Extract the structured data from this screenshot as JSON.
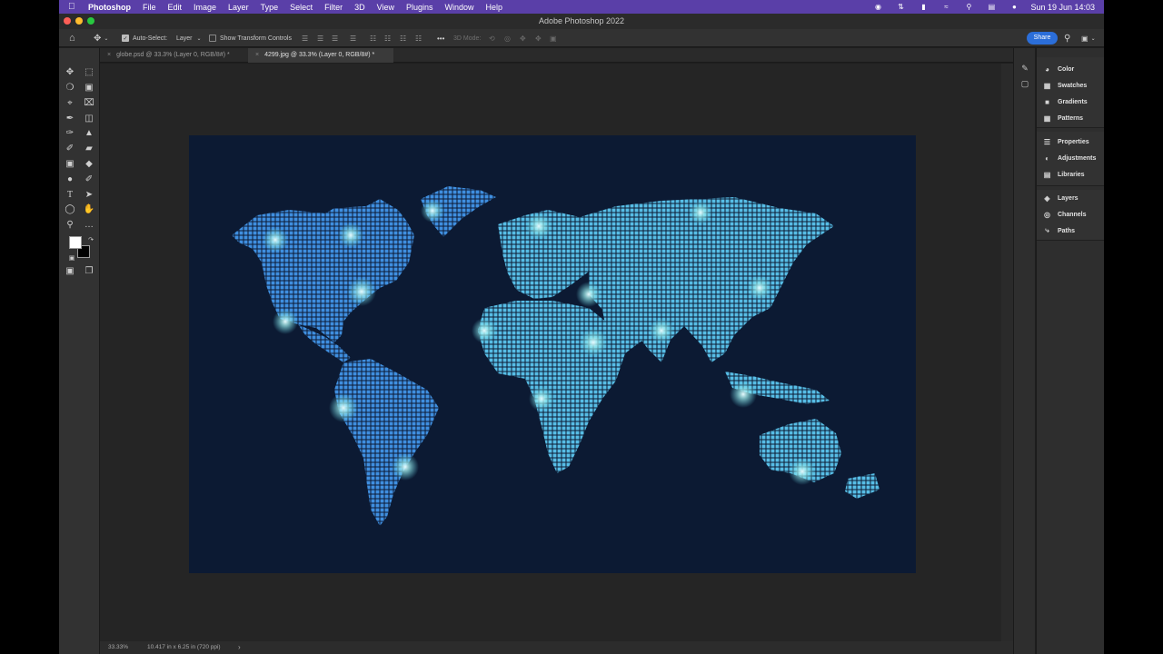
{
  "menubar": {
    "apple_icon": "apple-icon",
    "app_name": "Photoshop",
    "items": [
      "File",
      "Edit",
      "Image",
      "Layer",
      "Type",
      "Select",
      "Filter",
      "3D",
      "View",
      "Plugins",
      "Window",
      "Help"
    ],
    "status_icons": [
      "creative-cloud-icon",
      "control-icon",
      "battery-icon",
      "wifi-icon",
      "search-icon",
      "control-center-icon",
      "siri-icon"
    ],
    "clock": "Sun 19 Jun  14:03"
  },
  "window": {
    "title": "Adobe Photoshop 2022"
  },
  "options_bar": {
    "auto_select_label": "Auto-Select:",
    "auto_select_checked": true,
    "auto_select_value": "Layer",
    "transform_label": "Show Transform Controls",
    "transform_checked": false,
    "mode_3d_label": "3D Mode:",
    "share_label": "Share"
  },
  "tabs": [
    {
      "label": "globe.psd @ 33.3% (Layer 0, RGB/8#) *",
      "active": false
    },
    {
      "label": "4299.jpg @ 33.3% (Layer 0, RGB/8#) *",
      "active": true
    }
  ],
  "status_bar": {
    "zoom": "33.33%",
    "doc_info": "10.417 in x 6.25 in (720 ppi)"
  },
  "panels": {
    "group1": [
      "Color",
      "Swatches",
      "Gradients",
      "Patterns"
    ],
    "group2": [
      "Properties",
      "Adjustments",
      "Libraries"
    ],
    "group3": [
      "Layers",
      "Channels",
      "Paths"
    ]
  },
  "colors": {
    "menubar": "#5a3fa8",
    "artboard_bg": "#0c1a33",
    "map_dots": "#4aa3df",
    "map_dots_light": "#5cc3e6",
    "share_button": "#2b6ed9"
  }
}
